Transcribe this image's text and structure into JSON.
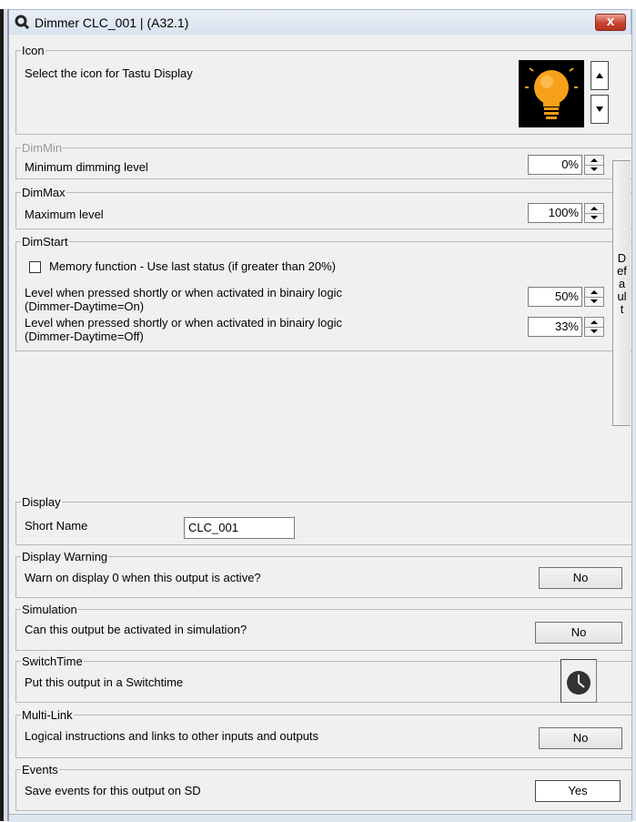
{
  "window": {
    "title": "Dimmer CLC_001 |  (A32.1)",
    "close_glyph": "x"
  },
  "icon_section": {
    "legend": "Icon",
    "description": "Select the icon for Tastu Display",
    "icon_name": "lightbulb-icon",
    "icon_bg": "#000000",
    "bulb_color": "#f7a11a"
  },
  "dim_min": {
    "legend": "DimMin",
    "label": "Minimum dimming level",
    "value": "0%"
  },
  "dim_max": {
    "legend": "DimMax",
    "label": "Maximum level",
    "value": "100%"
  },
  "dim_start": {
    "legend": "DimStart",
    "memory_label": "Memory function - Use last status (if greater than 20%)",
    "memory_checked": false,
    "level_on_label_1": "Level when pressed shortly or when activated in binairy logic",
    "level_on_label_2": "(Dimmer-Daytime=On)",
    "level_on_value": "50%",
    "level_off_label_1": "Level when pressed shortly or when activated in binairy logic",
    "level_off_label_2": "(Dimmer-Daytime=Off)",
    "level_off_value": "33%"
  },
  "default_button": {
    "letters": [
      "D",
      "ef",
      "a",
      "ul",
      "t"
    ]
  },
  "display": {
    "legend": "Display",
    "short_name_label": "Short Name",
    "short_name_value": "CLC_001"
  },
  "display_warning": {
    "legend": "Display Warning",
    "label": "Warn on display 0 when this output is active?",
    "value": "No"
  },
  "simulation": {
    "legend": "Simulation",
    "label": "Can this output be activated in simulation?",
    "value": "No"
  },
  "switch_time": {
    "legend": "SwitchTime",
    "label": "Put this output in a Switchtime",
    "icon_name": "clock-icon"
  },
  "multi_link": {
    "legend": "Multi-Link",
    "label": "Logical instructions and links to other inputs and outputs",
    "value": "No"
  },
  "events": {
    "legend": "Events",
    "label": "Save events for this output on SD",
    "value": "Yes"
  }
}
